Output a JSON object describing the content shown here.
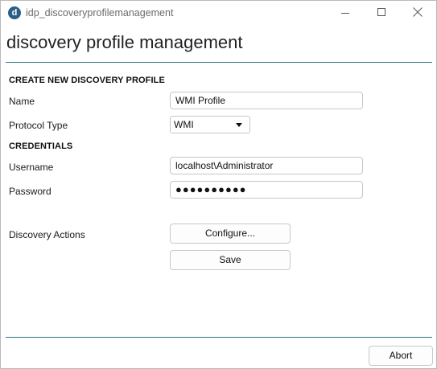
{
  "window": {
    "title": "idp_discoveryprofilemanagement",
    "app_icon_letter": "d"
  },
  "page": {
    "heading": "discovery profile management"
  },
  "create_section": {
    "title": "CREATE NEW DISCOVERY PROFILE",
    "name_label": "Name",
    "name_value": "WMI Profile",
    "protocol_label": "Protocol Type",
    "protocol_value": "WMI"
  },
  "credentials_section": {
    "title": "CREDENTIALS",
    "username_label": "Username",
    "username_value": "localhost\\Administrator",
    "password_label": "Password",
    "password_value": "●●●●●●●●●●"
  },
  "actions": {
    "label": "Discovery Actions",
    "configure_label": "Configure...",
    "save_label": "Save",
    "abort_label": "Abort"
  },
  "colors": {
    "accent_rule": "#2c7382",
    "app_icon": "#2a5f8a"
  },
  "icons": {
    "app": "app-logo-icon",
    "minimize": "minimize-icon",
    "maximize": "maximize-icon",
    "close": "close-icon",
    "dropdown": "chevron-down-icon"
  }
}
